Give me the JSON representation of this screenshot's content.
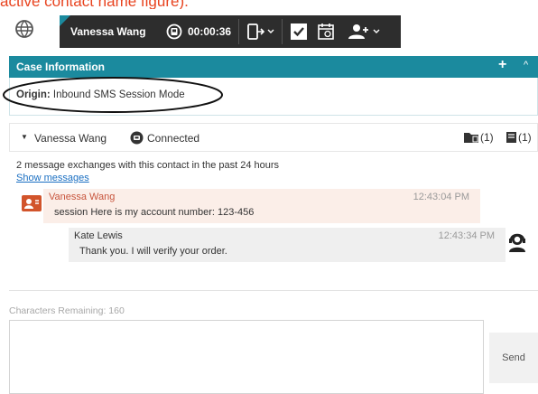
{
  "caption": "active contact name figure).",
  "toolbar": {
    "globe_icon": "globe-icon",
    "agent_name": "Vanessa Wang",
    "timer": "00:00:36",
    "icons": [
      "hold-icon",
      "transfer-icon",
      "done-icon",
      "schedule-icon",
      "add-participant-icon"
    ]
  },
  "case_info": {
    "title": "Case Information",
    "plus": "+",
    "caret": "^",
    "origin_label": "Origin:",
    "origin_value": "Inbound SMS Session Mode"
  },
  "contact": {
    "name": "Vanessa Wang",
    "status": "Connected",
    "badge_cases": "(1)",
    "badge_notes": "(1)"
  },
  "transcript": {
    "exchanges_text": "2 message exchanges with this contact in the past 24 hours",
    "show_messages": "Show messages",
    "messages": [
      {
        "sender": "Vanessa Wang",
        "time": "12:43:04 PM",
        "text": "session Here is my account number: 123-456"
      },
      {
        "sender": "Kate Lewis",
        "time": "12:43:34 PM",
        "text": "Thank you. I will verify your order."
      }
    ]
  },
  "compose": {
    "chars_remaining": "Characters Remaining: 160",
    "text": "",
    "send_label": "Send"
  },
  "colors": {
    "accent_teal": "#1b8a9e",
    "toolbar_dark": "#2d2d2d",
    "incoming_bg": "#fbeee8",
    "incoming_sender": "#c8553d",
    "outgoing_bg": "#efefef",
    "link": "#1a6fc2"
  }
}
